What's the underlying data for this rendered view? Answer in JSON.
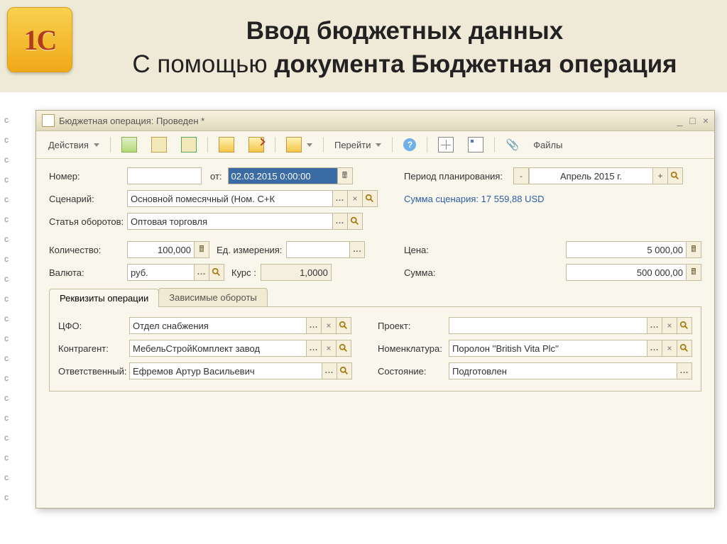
{
  "slide": {
    "title_line1": "Ввод бюджетных данных",
    "title_line2_prefix": "С помощью ",
    "title_line2_bold": "документа Бюджетная операция",
    "logo_text": "1C"
  },
  "window": {
    "title": "Бюджетная операция: Проведен *",
    "min_icon": "_",
    "max_icon": "□",
    "close_icon": "×"
  },
  "toolbar": {
    "actions": "Действия",
    "go": "Перейти",
    "help": "?",
    "files": "Файлы",
    "clip": "📎"
  },
  "labels": {
    "number": "Номер:",
    "from": "от:",
    "plan_period": "Период планирования:",
    "scenario": "Сценарий:",
    "scenario_sum": "Сумма сценария: 17 559,88 USD",
    "item": "Статья оборотов:",
    "qty": "Количество:",
    "unit": "Ед. измерения:",
    "price": "Цена:",
    "currency": "Валюта:",
    "rate": "Курс :",
    "sum": "Сумма:",
    "cfo": "ЦФО:",
    "project": "Проект:",
    "counterparty": "Контрагент:",
    "nomenclature": "Номенклатура:",
    "responsible": "Ответственный:",
    "status": "Состояние:"
  },
  "values": {
    "number": "",
    "date": "02.03.2015  0:00:00",
    "period": "Апрель 2015 г.",
    "period_minus": "-",
    "period_plus": "+",
    "scenario": "Основной помесячный (Ном. С+К",
    "item": "Оптовая торговля",
    "qty": "100,000",
    "unit": "",
    "price": "5 000,00",
    "currency": "руб.",
    "rate": "1,0000",
    "sum": "500 000,00",
    "cfo": "Отдел снабжения",
    "project": "",
    "counterparty": "МебельСтройКомплект завод",
    "nomenclature": "Поролон ''British Vita Plc''",
    "responsible": "Ефремов Артур Васильевич",
    "status": "Подготовлен"
  },
  "tabs": {
    "t1": "Реквизиты операции",
    "t2": "Зависимые обороты"
  },
  "icons": {
    "ellipsis": "...",
    "x": "×",
    "calc": "🖩"
  }
}
